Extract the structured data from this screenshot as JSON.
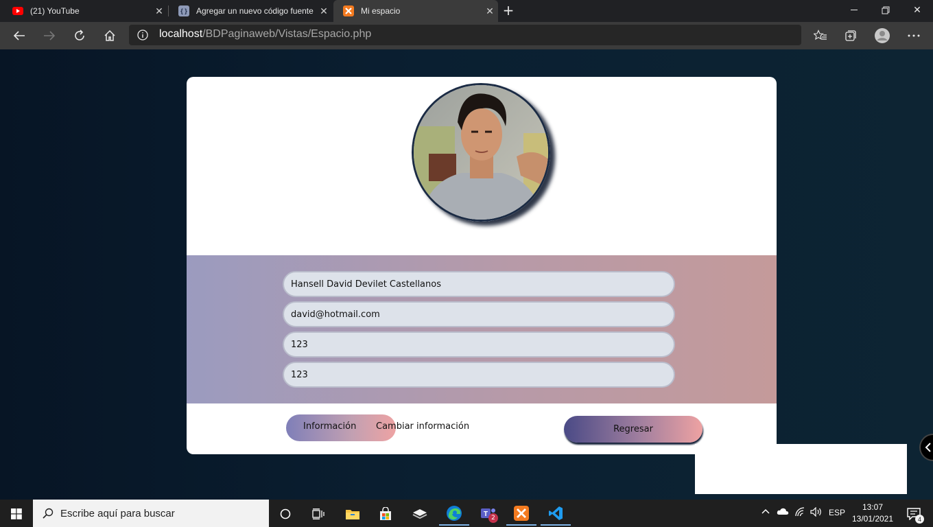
{
  "browser": {
    "tabs": [
      {
        "title": "(21) YouTube",
        "icon": "youtube-icon"
      },
      {
        "title": "Agregar un nuevo código fuente",
        "icon": "code-icon"
      },
      {
        "title": "Mi espacio",
        "icon": "xampp-icon"
      }
    ],
    "url_host": "localhost",
    "url_path": "/BDPaginaweb/Vistas/Espacio.php"
  },
  "profile": {
    "name": "Hansell David Devilet Castellanos",
    "email": "david@hotmail.com",
    "field3": "123",
    "field4": "123"
  },
  "actions": {
    "info_label": "Información",
    "change_label": "Cambiar información",
    "back_label": "Regresar"
  },
  "taskbar": {
    "search_placeholder": "Escribe aquí para buscar",
    "teams_badge": "2",
    "language": "ESP",
    "time": "13:07",
    "date": "13/01/2021",
    "notifications": "4"
  },
  "colors": {
    "accent_band_start": "#9b9bbf",
    "accent_band_end": "#c49a9a",
    "button_gradient_start": "#4a4a86",
    "button_gradient_end": "#eea2a2"
  }
}
